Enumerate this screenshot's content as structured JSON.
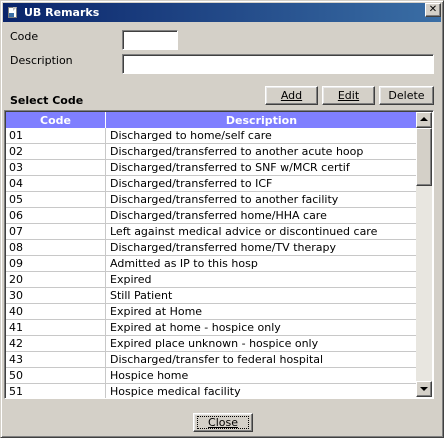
{
  "window": {
    "title": "UB Remarks",
    "close_glyph": "✕"
  },
  "form": {
    "code_label": "Code",
    "code_value": "",
    "description_label": "Description",
    "description_value": ""
  },
  "section": {
    "select_code_label": "Select Code"
  },
  "toolbar": {
    "add_label": "Add",
    "edit_label": "Edit",
    "delete_label": "Delete"
  },
  "grid": {
    "columns": [
      "Code",
      "Description"
    ],
    "header_color": "#7f7fff",
    "rows": [
      {
        "code": "01",
        "description": "Discharged to home/self care"
      },
      {
        "code": "02",
        "description": "Discharged/transferred to another acute hoop"
      },
      {
        "code": "03",
        "description": "Discharged/transferred to SNF w/MCR certif"
      },
      {
        "code": "04",
        "description": "Discharged/transferred to ICF"
      },
      {
        "code": "05",
        "description": "Discharged/transferred to another facility"
      },
      {
        "code": "06",
        "description": "Discharged/transferred home/HHA care"
      },
      {
        "code": "07",
        "description": "Left against medical advice or discontinued care"
      },
      {
        "code": "08",
        "description": "Discharged/transferred home/TV therapy"
      },
      {
        "code": "09",
        "description": "Admitted as IP to this hosp"
      },
      {
        "code": "20",
        "description": "Expired"
      },
      {
        "code": "30",
        "description": "Still Patient"
      },
      {
        "code": "40",
        "description": "Expired at Home"
      },
      {
        "code": "41",
        "description": "Expired at home - hospice only"
      },
      {
        "code": "42",
        "description": "Expired place unknown - hospice only"
      },
      {
        "code": "43",
        "description": "Discharged/transfer to federal hospital"
      },
      {
        "code": "50",
        "description": "Hospice home"
      },
      {
        "code": "51",
        "description": "Hospice medical facility"
      }
    ]
  },
  "footer": {
    "close_label": "Close"
  },
  "colors": {
    "titlebar_start": "#0a246a",
    "titlebar_end": "#3a6ea5",
    "face": "#d4d0c8"
  }
}
